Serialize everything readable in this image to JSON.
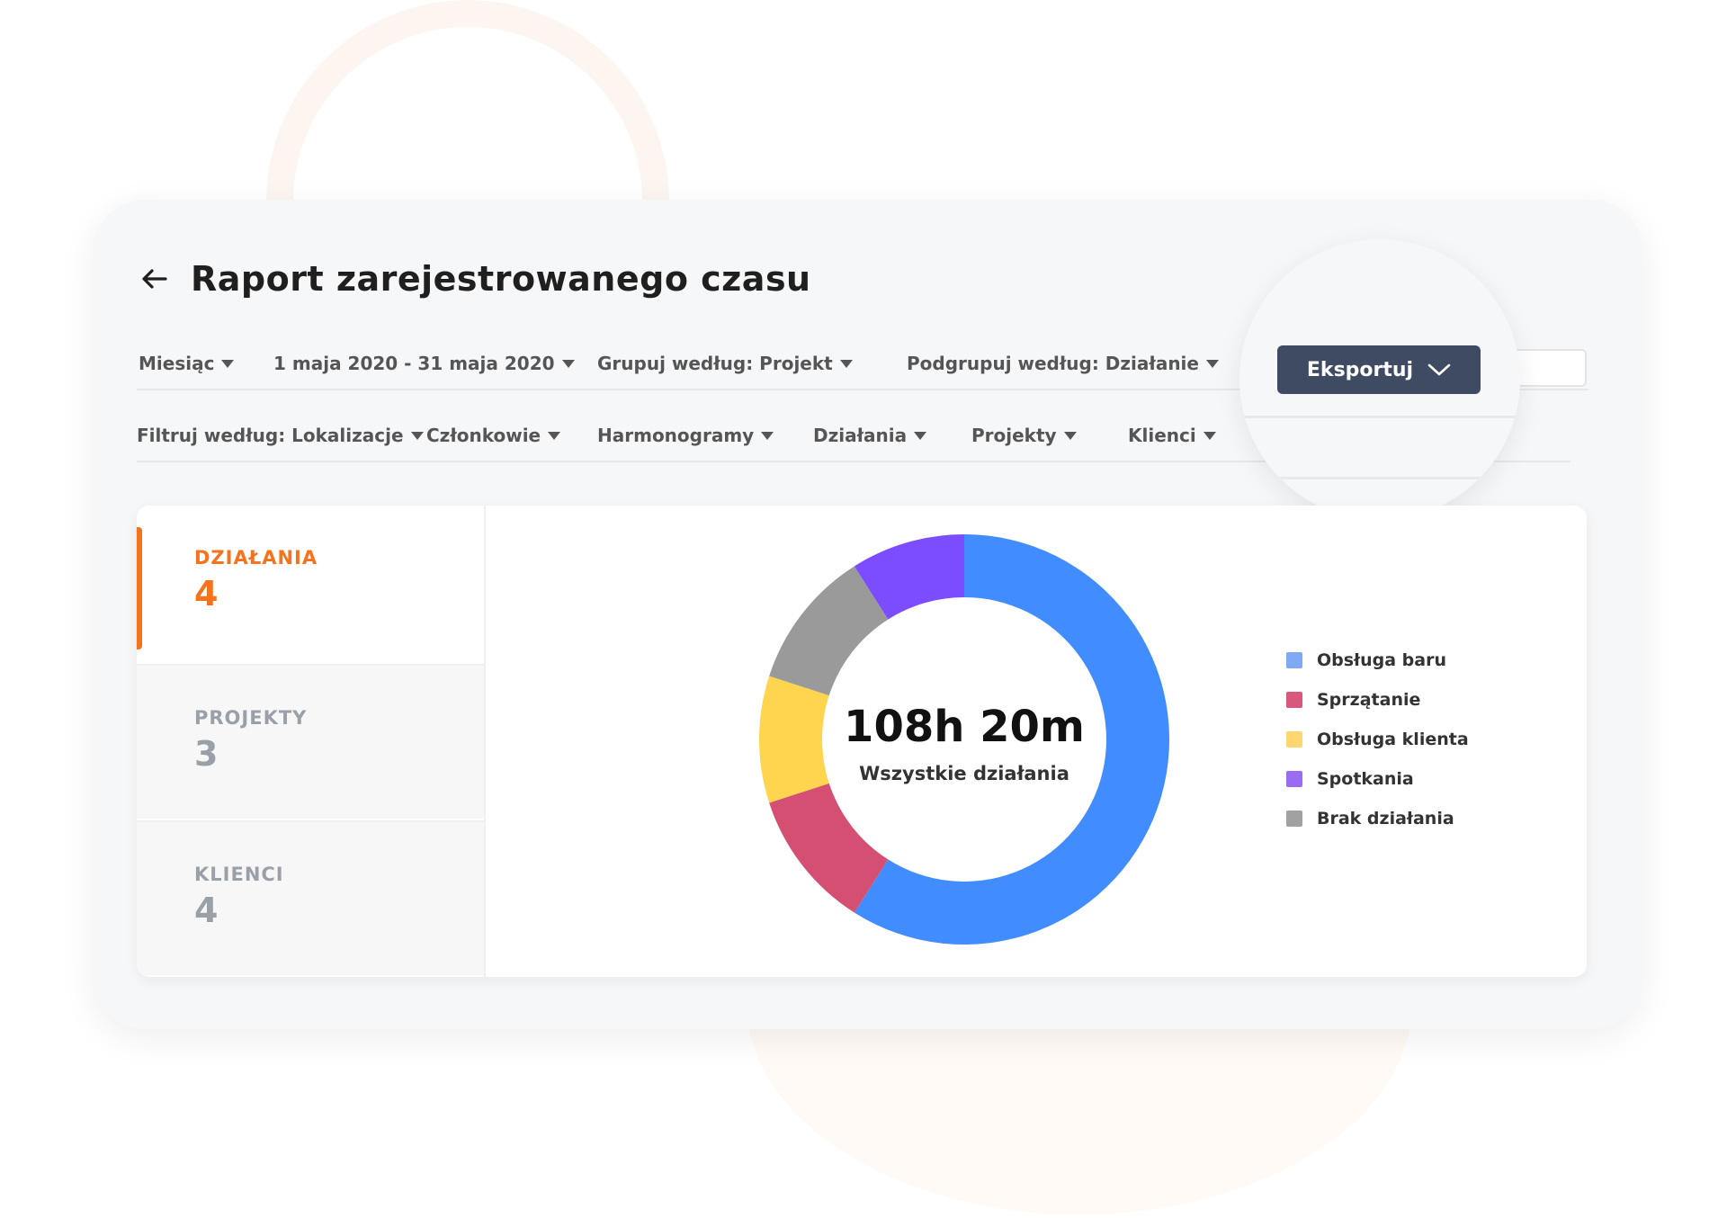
{
  "header": {
    "title": "Raport zarejestrowanego czasu"
  },
  "filters_row1": [
    {
      "label": "Miesiąc"
    },
    {
      "label": "1 maja 2020 - 31 maja 2020"
    },
    {
      "label": "Grupuj według: Projekt"
    },
    {
      "label": "Podgrupuj według: Działanie"
    }
  ],
  "filters_row2": [
    {
      "label": "Filtruj według: Lokalizacje"
    },
    {
      "label": "Członkowie"
    },
    {
      "label": "Harmonogramy"
    },
    {
      "label": "Działania"
    },
    {
      "label": "Projekty"
    },
    {
      "label": "Klienci"
    }
  ],
  "export": {
    "label": "Eksportuj"
  },
  "sidebar": {
    "items": [
      {
        "label": "DZIAŁANIA",
        "value": "4",
        "active": true
      },
      {
        "label": "PROJEKTY",
        "value": "3",
        "active": false
      },
      {
        "label": "KLIENCI",
        "value": "4",
        "active": false
      }
    ]
  },
  "chart_data": {
    "type": "pie",
    "center_total": "108h 20m",
    "center_label": "Wszystkie działania",
    "series": [
      {
        "name": "Obsługa baru",
        "value": 59,
        "color": "#418cff",
        "swatch": "#7fa9f5"
      },
      {
        "name": "Sprzątanie",
        "value": 11,
        "color": "#d44f72",
        "swatch": "#d9577b"
      },
      {
        "name": "Obsługa klienta",
        "value": 10,
        "color": "#ffd54f",
        "swatch": "#ffd670"
      },
      {
        "name": "Brak działania",
        "value": 11,
        "color": "#9a9a9a",
        "swatch": "#a1a1a1"
      },
      {
        "name": "Spotkania",
        "value": 9,
        "color": "#7c4dff",
        "swatch": "#9a6cf2"
      }
    ],
    "legend_order": [
      "Obsługa baru",
      "Sprzątanie",
      "Obsługa klienta",
      "Spotkania",
      "Brak działania"
    ]
  }
}
